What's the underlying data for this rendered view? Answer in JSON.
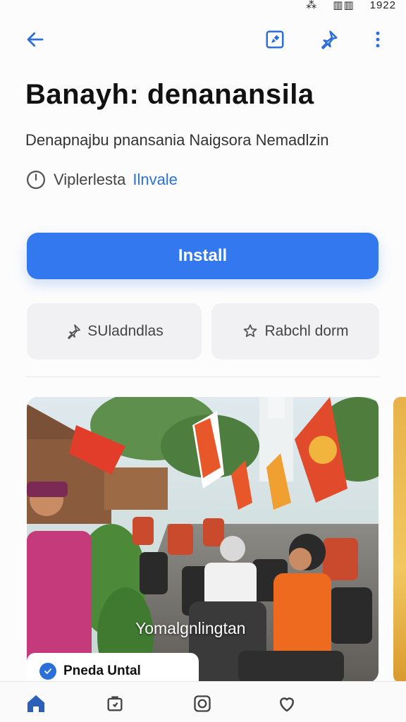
{
  "status_bar": {
    "left_glyph": "⁂",
    "signal": "▥▥",
    "time": "1922"
  },
  "header": {
    "back_icon": "arrow-left-icon",
    "edit_icon": "edit-box-icon",
    "share_icon": "pin-icon",
    "more_icon": "more-vertical-icon"
  },
  "app": {
    "title": "Banayh: denanansila",
    "developer": "Denapnajbu pnansania Naigsora Nemadlzin",
    "meta_prefix": "Viplerlesta",
    "meta_link": "Ilnvale"
  },
  "actions": {
    "install_label": "Install",
    "chip_left_label": "SUladndlas",
    "chip_right_label": "Rabchl dorm"
  },
  "media": {
    "caption": "Yomalgnlingtan",
    "badge_label": "Pneda Untal"
  },
  "bottom_nav": [
    {
      "icon": "home-icon",
      "label": ""
    },
    {
      "icon": "apps-icon",
      "label": ""
    },
    {
      "icon": "games-icon",
      "label": ""
    },
    {
      "icon": "heart-icon",
      "label": ""
    }
  ],
  "colors": {
    "accent": "#3478f0",
    "link": "#2b72d8",
    "check": "#2b6fd8"
  }
}
